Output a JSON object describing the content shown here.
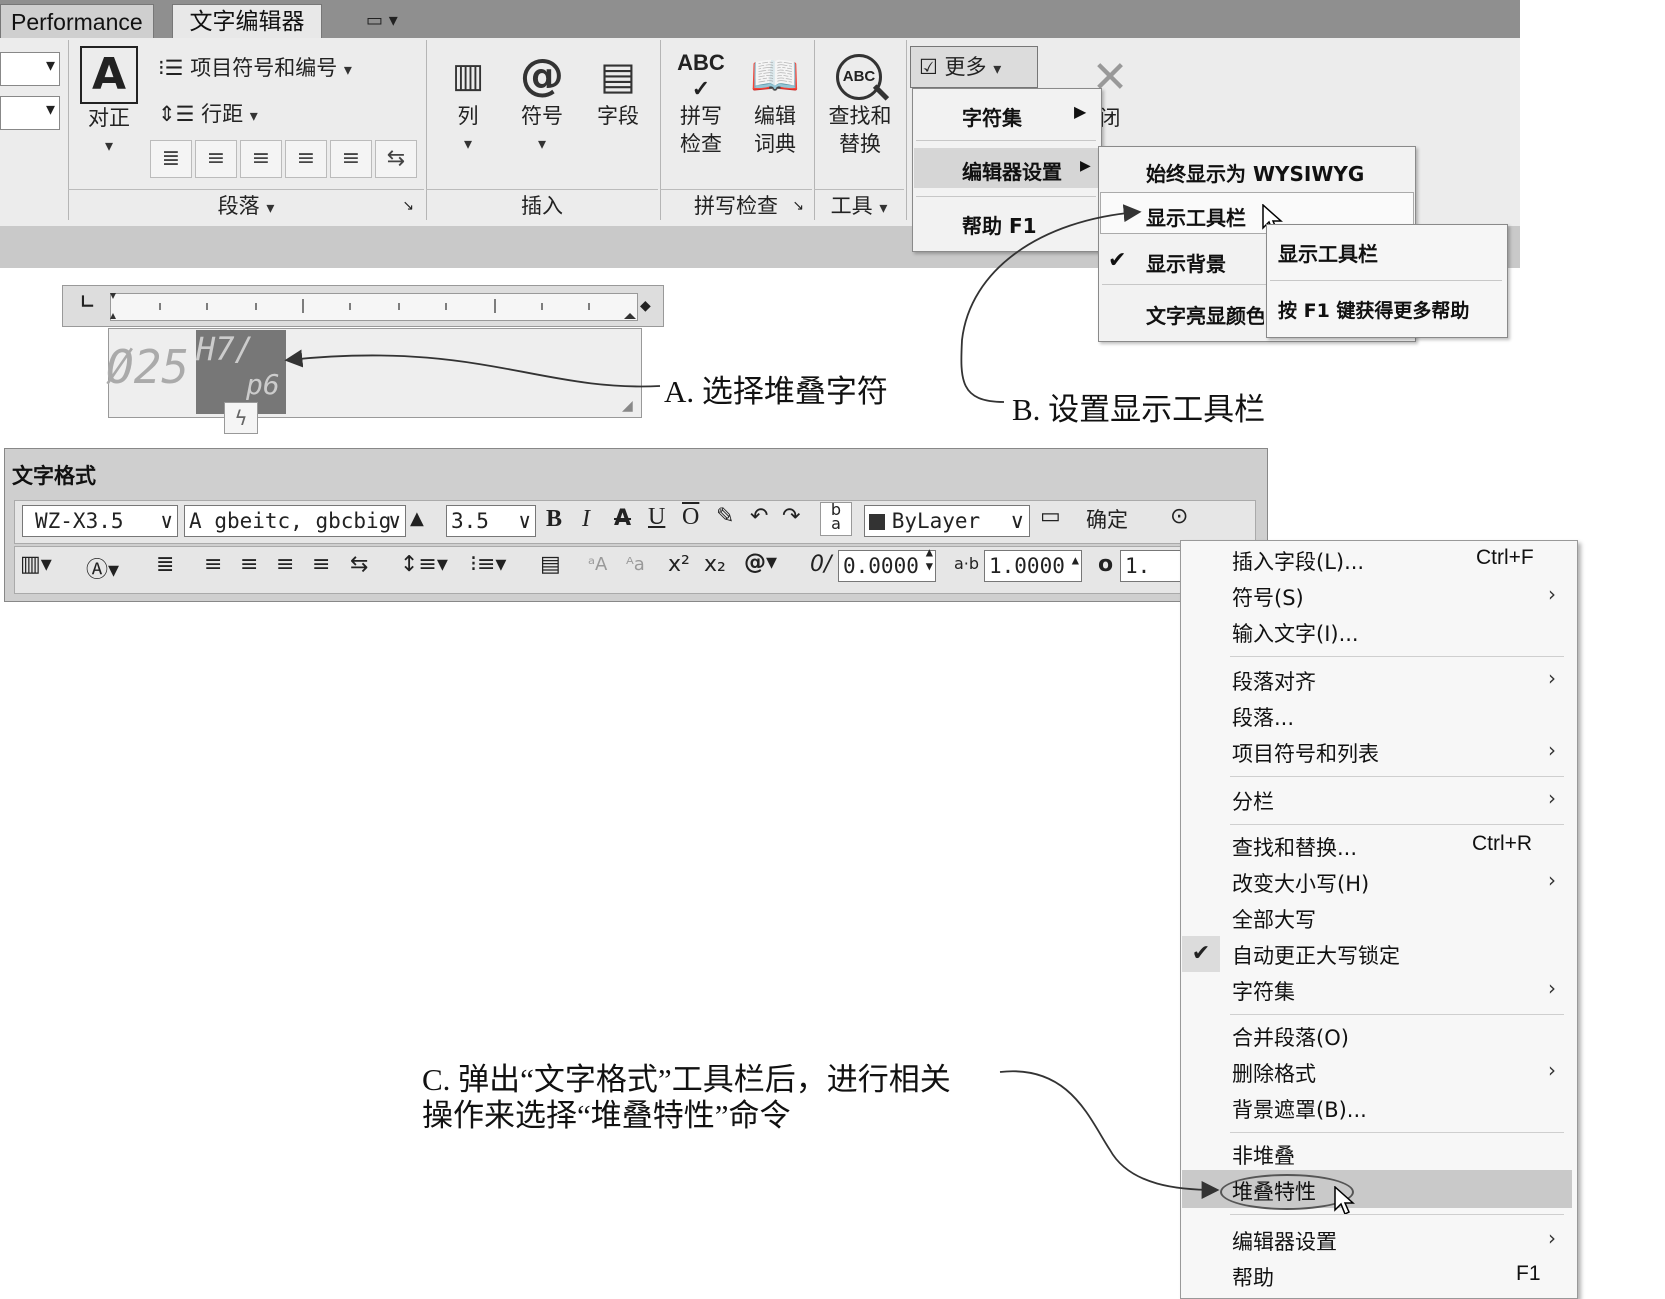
{
  "ribbon": {
    "tabs": [
      "Performance",
      "文字编辑器"
    ],
    "justify_label": "对正",
    "bullets_label": "项目符号和编号",
    "linespace_label": "行距",
    "column_label": "列",
    "symbol_label": "符号",
    "field_label": "字段",
    "spell_label": [
      "拼写",
      "检查"
    ],
    "dict_label": [
      "编辑",
      "词典"
    ],
    "find_label": [
      "查找和",
      "替换"
    ],
    "more_label": "更多",
    "close_label": "闭",
    "groups": {
      "paragraph": "段落",
      "insert": "插入",
      "spellcheck": "拼写检查",
      "tools": "工具"
    }
  },
  "more_menu": {
    "items": [
      "字符集",
      "编辑器设置",
      "帮助 F1"
    ]
  },
  "editor_settings_menu": {
    "items": [
      "始终显示为 WYSIWYG",
      "显示工具栏",
      "显示背景",
      "文字亮显颜色"
    ]
  },
  "toolbar_submenu": {
    "items": [
      "显示工具栏",
      "按 F1 键获得更多帮助"
    ]
  },
  "editor": {
    "text_main": "Ø25",
    "stack_top": "H7/",
    "stack_bottom": "p6"
  },
  "text_format": {
    "title": "文字格式",
    "style": "WZ-X3.5",
    "font": "gbeitc, gbcbig",
    "height": "3.5",
    "color": "ByLayer",
    "ok_label": "确定",
    "oblique": "0.0000",
    "tracking": "1.0000",
    "width_factor": "1."
  },
  "context_menu": {
    "groups": [
      [
        {
          "label": "插入字段(L)...",
          "shortcut": "Ctrl+F"
        },
        {
          "label": "符号(S)",
          "submenu": true
        },
        {
          "label": "输入文字(I)..."
        }
      ],
      [
        {
          "label": "段落对齐",
          "submenu": true
        },
        {
          "label": "段落..."
        },
        {
          "label": "项目符号和列表",
          "submenu": true
        }
      ],
      [
        {
          "label": "分栏",
          "submenu": true
        }
      ],
      [
        {
          "label": "查找和替换...",
          "shortcut": "Ctrl+R"
        },
        {
          "label": "改变大小写(H)",
          "submenu": true
        },
        {
          "label": "全部大写"
        },
        {
          "label": "自动更正大写锁定",
          "checked": true
        },
        {
          "label": "字符集",
          "submenu": true
        }
      ],
      [
        {
          "label": "合并段落(O)"
        },
        {
          "label": "删除格式",
          "submenu": true
        },
        {
          "label": "背景遮罩(B)..."
        }
      ],
      [
        {
          "label": "非堆叠"
        },
        {
          "label": "堆叠特性",
          "highlighted": true
        }
      ],
      [
        {
          "label": "编辑器设置",
          "submenu": true
        },
        {
          "label": "帮助",
          "shortcut": "F1"
        }
      ]
    ]
  },
  "annotations": {
    "a": "A. 选择堆叠字符",
    "b": "B. 设置显示工具栏",
    "c_line1": "C. 弹出“文字格式”工具栏后，进行相关",
    "c_line2": "操作来选择“堆叠特性”命令"
  }
}
